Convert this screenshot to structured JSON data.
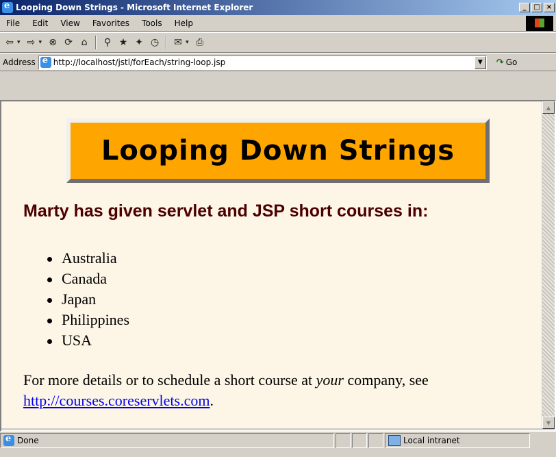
{
  "window": {
    "title": "Looping Down Strings - Microsoft Internet Explorer",
    "minimize_label": "_",
    "maximize_label": "□",
    "close_label": "×"
  },
  "menu": {
    "items": [
      "File",
      "Edit",
      "View",
      "Favorites",
      "Tools",
      "Help"
    ]
  },
  "toolbar": {
    "back_icon": "⇦",
    "dropdown_glyph": "▾",
    "forward_icon": "⇨",
    "stop_icon": "⊗",
    "refresh_icon": "⟳",
    "home_icon": "⌂",
    "search_icon": "⚲",
    "favorites_icon": "★",
    "media_icon": "✦",
    "history_icon": "◷",
    "mail_icon": "✉",
    "print_icon": "⎙"
  },
  "address": {
    "label": "Address",
    "url": "http://localhost/jstl/forEach/string-loop.jsp",
    "dropdown_glyph": "▼",
    "go_arrow": "↷",
    "go_label": "Go"
  },
  "page": {
    "banner_title": "Looping Down Strings",
    "heading": "Marty has given servlet and JSP short courses in:",
    "courses": [
      "Australia",
      "Canada",
      "Japan",
      "Philippines",
      "USA"
    ],
    "details_before": "For more details or to schedule a short course at ",
    "details_emphasis": "your",
    "details_middle": " company, see ",
    "details_link": "http://courses.coreservlets.com",
    "details_after": "."
  },
  "scrollbar": {
    "up_glyph": "▲",
    "down_glyph": "▼"
  },
  "status": {
    "text": "Done",
    "zone": "Local intranet"
  },
  "colors": {
    "banner_bg": "#ffa500",
    "page_bg": "#fdf5e6",
    "heading": "#4b0000",
    "link": "#0000ee"
  }
}
